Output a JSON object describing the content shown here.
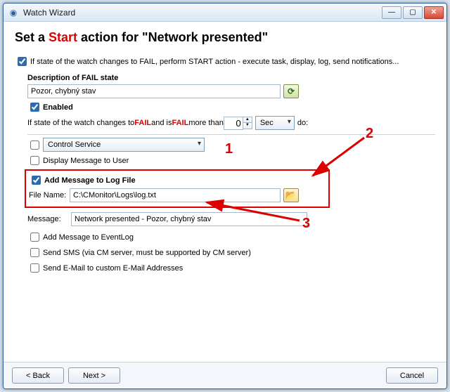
{
  "window": {
    "title": "Watch Wizard"
  },
  "heading": {
    "prefix": "Set a ",
    "start_word": "Start",
    "middle": " action for \"",
    "watch_name": "Network presented",
    "suffix": "\""
  },
  "top_check": {
    "label": "If state of the watch changes to FAIL, perform START action - execute task, display, log, send notifications..."
  },
  "desc": {
    "label": "Description of FAIL state",
    "value": "Pozor, chybný stav",
    "enabled_label": "Enabled",
    "cond_prefix": "If state of the watch changes to ",
    "cond_fail1": "FAIL",
    "cond_mid": " and is ",
    "cond_fail2": "FAIL",
    "cond_more": " more than ",
    "count": "0",
    "unit": "Sec",
    "do": "  do:"
  },
  "action_select": "Control Service",
  "opts": {
    "display_msg": "Display Message to User",
    "add_log": "Add Message to Log File",
    "file_label": "File Name:",
    "file_value": "C:\\CMonitor\\Logs\\log.txt",
    "msg_label": "Message:",
    "msg_value": "Network presented - Pozor, chybný stav",
    "eventlog": "Add Message to EventLog",
    "sms": "Send SMS (via CM server, must be supported by CM server)",
    "email": "Send E-Mail to custom E-Mail Addresses"
  },
  "footer": {
    "back": "< Back",
    "next": "Next >",
    "cancel": "Cancel"
  },
  "callouts": {
    "c1": "1",
    "c2": "2",
    "c3": "3"
  }
}
